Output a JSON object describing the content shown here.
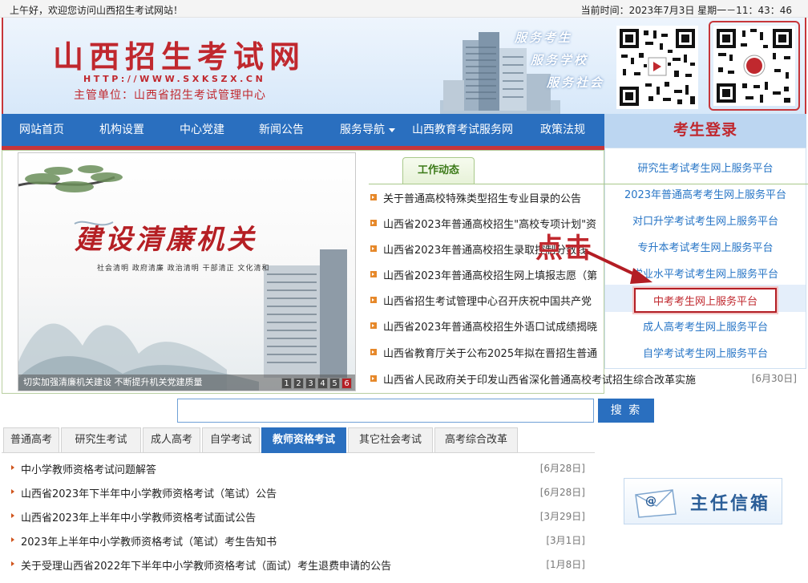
{
  "topbar": {
    "greeting": "上午好，欢迎您访问山西招生考试网站！",
    "clock": "当前时间：2023年7月3日 星期一－11：43：46"
  },
  "header": {
    "title": "山西招生考试网",
    "url": "HTTP://WWW.SXKSZX.CN",
    "sponsor": "主管单位：山西省招生考试管理中心",
    "slogans": [
      "服务考生",
      "服务学校",
      "服务社会"
    ]
  },
  "nav": {
    "items": [
      {
        "label": "网站首页"
      },
      {
        "label": "机构设置"
      },
      {
        "label": "中心党建"
      },
      {
        "label": "新闻公告"
      },
      {
        "label": "服务导航"
      },
      {
        "label": "山西教育考试服务网"
      },
      {
        "label": "政策法规"
      }
    ]
  },
  "login": {
    "title": "考生登录",
    "links": [
      "研究生考试考生网上服务平台",
      "2023年普通高考考生网上服务平台",
      "对口升学考试考生网上服务平台",
      "专升本考试考生网上服务平台",
      "学业水平考试考生网上服务平台",
      "中考考生网上服务平台",
      "成人高考考生网上服务平台",
      "自学考试考生网上服务平台"
    ]
  },
  "annotation": {
    "text": "点击"
  },
  "banner": {
    "title": "建设清廉机关",
    "subtitle": "社会清明  政府清廉  政治清明  干部清正  文化清和",
    "caption": "切实加强清廉机关建设 不断提升机关党建质量",
    "pages": [
      "1",
      "2",
      "3",
      "4",
      "5",
      "6"
    ]
  },
  "news": {
    "tab": "工作动态",
    "items": [
      {
        "text": "关于普通高校特殊类型招生专业目录的公告",
        "date": ""
      },
      {
        "text": "山西省2023年普通高校招生\"高校专项计划\"资",
        "date": ""
      },
      {
        "text": "山西省2023年普通高校招生录取控制分数线",
        "date": ""
      },
      {
        "text": "山西省2023年普通高校招生网上填报志愿（第",
        "date": ""
      },
      {
        "text": "山西省招生考试管理中心召开庆祝中国共产党",
        "date": ""
      },
      {
        "text": "山西省2023年普通高校招生外语口试成绩揭晓",
        "date": ""
      },
      {
        "text": "山西省教育厅关于公布2025年拟在晋招生普通",
        "date": ""
      },
      {
        "text": "山西省人民政府关于印发山西省深化普通高校考试招生综合改革实施",
        "date": "[6月30日]"
      }
    ]
  },
  "search": {
    "placeholder": "",
    "button": "搜 索"
  },
  "categories": {
    "tabs": [
      "普通高考",
      "研究生考试",
      "成人高考",
      "自学考试",
      "教师资格考试",
      "其它社会考试",
      "高考综合改革"
    ],
    "active_index": 4,
    "items": [
      {
        "text": "中小学教师资格考试问题解答",
        "date": "[6月28日]"
      },
      {
        "text": "山西省2023年下半年中小学教师资格考试（笔试）公告",
        "date": "[6月28日]"
      },
      {
        "text": "山西省2023年上半年中小学教师资格考试面试公告",
        "date": "[3月29日]"
      },
      {
        "text": "2023年上半年中小学教师资格考试（笔试）考生告知书",
        "date": "[3月1日]"
      },
      {
        "text": "关于受理山西省2022年下半年中小学教师资格考试（面试）考生退费申请的公告",
        "date": "[1月8日]"
      }
    ]
  },
  "mailbox": {
    "label": "主任信箱"
  },
  "colors": {
    "brand_red": "#c0282e",
    "nav_blue": "#2a6fbf",
    "link_blue": "#2775c6"
  }
}
